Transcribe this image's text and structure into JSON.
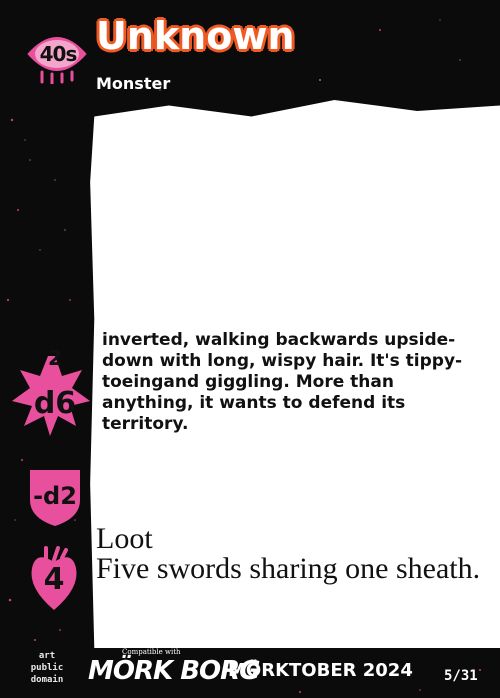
{
  "card": {
    "hp": "40s",
    "title": "Unknown",
    "type": "Monster",
    "description": "inverted, walking backwards upside-down with long, wispy hair. It's tippy-toeingand giggling. More than anything, it wants to defend its territory.",
    "morale_top": "2",
    "morale_die": "d6",
    "armor": "-d2",
    "attack": "4",
    "loot_title": "Loot",
    "loot_text": "Five swords sharing one sheath."
  },
  "footer": {
    "credit_line1": "art",
    "credit_line2": "public",
    "credit_line3": "domain",
    "compat_text": "Compatible with",
    "logo_text": "MÖRK BORG",
    "event_text": "MÖRKTOBER 2024",
    "page": "5/31"
  },
  "colors": {
    "title_outline": "#ef5a24",
    "accent_pink": "#e84f9c",
    "background": "#0b0b0b",
    "panel": "#ffffff"
  },
  "icons": [
    "eye-icon",
    "sun-badge-icon",
    "shield-icon",
    "heart-icon"
  ]
}
